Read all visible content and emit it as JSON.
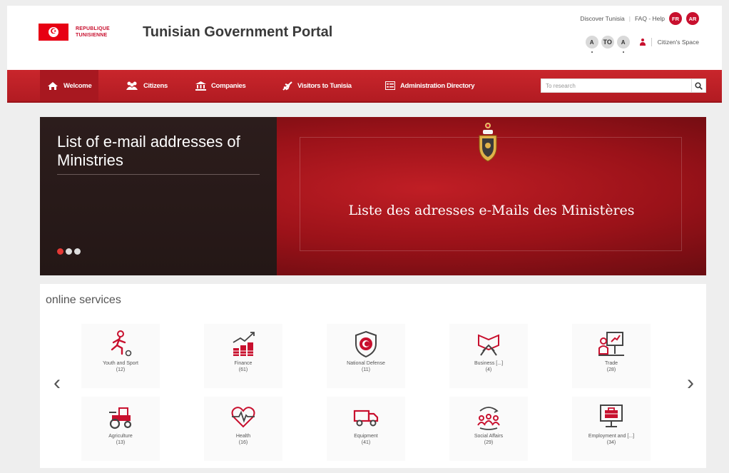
{
  "header": {
    "logo_line1": "REPUBLIQUE",
    "logo_line2": "TUNISIENNE",
    "title": "Tunisian Government Portal",
    "top_links": {
      "discover": "Discover Tunisia",
      "faq": "FAQ - Help",
      "lang_fr": "FR",
      "lang_ar": "AR"
    },
    "a11y": {
      "font_small": "A",
      "font_mid": "TO",
      "font_large": "A",
      "citizen_space": "Citizen's Space"
    }
  },
  "nav": {
    "items": [
      {
        "label": "Welcome",
        "icon": "home-icon",
        "active": true
      },
      {
        "label": "Citizens",
        "icon": "people-icon"
      },
      {
        "label": "Companies",
        "icon": "building-icon"
      },
      {
        "label": "Visitors to Tunisia",
        "icon": "plane-icon"
      },
      {
        "label": "Administration Directory",
        "icon": "directory-icon"
      }
    ],
    "search_placeholder": "To research"
  },
  "banner": {
    "title": "List of e-mail addresses of Ministries",
    "subtitle": "Liste des adresses e-Mails des Ministères",
    "slides": 3,
    "active_slide": 1
  },
  "services": {
    "heading": "online services",
    "prev": "‹",
    "next": "›",
    "tiles": [
      {
        "name": "Youth and Sport",
        "count": "(12)",
        "icon": "sport-icon"
      },
      {
        "name": "Finance",
        "count": "(61)",
        "icon": "finance-icon"
      },
      {
        "name": "National Defense",
        "count": "(11)",
        "icon": "shield-icon"
      },
      {
        "name": "Business [...]",
        "count": "(4)",
        "icon": "handshake-icon"
      },
      {
        "name": "Trade",
        "count": "(28)",
        "icon": "presentation-icon"
      },
      {
        "name": "Agriculture",
        "count": "(13)",
        "icon": "tractor-icon"
      },
      {
        "name": "Health",
        "count": "(16)",
        "icon": "heart-pulse-icon"
      },
      {
        "name": "Equipment",
        "count": "(41)",
        "icon": "truck-icon"
      },
      {
        "name": "Social Affairs",
        "count": "(29)",
        "icon": "community-icon"
      },
      {
        "name": "Employment and [...]",
        "count": "(34)",
        "icon": "briefcase-monitor-icon"
      }
    ]
  },
  "colors": {
    "primary_red": "#c8102e",
    "nav_red": "#c9262c",
    "dark_banner": "#2c1d1c"
  }
}
